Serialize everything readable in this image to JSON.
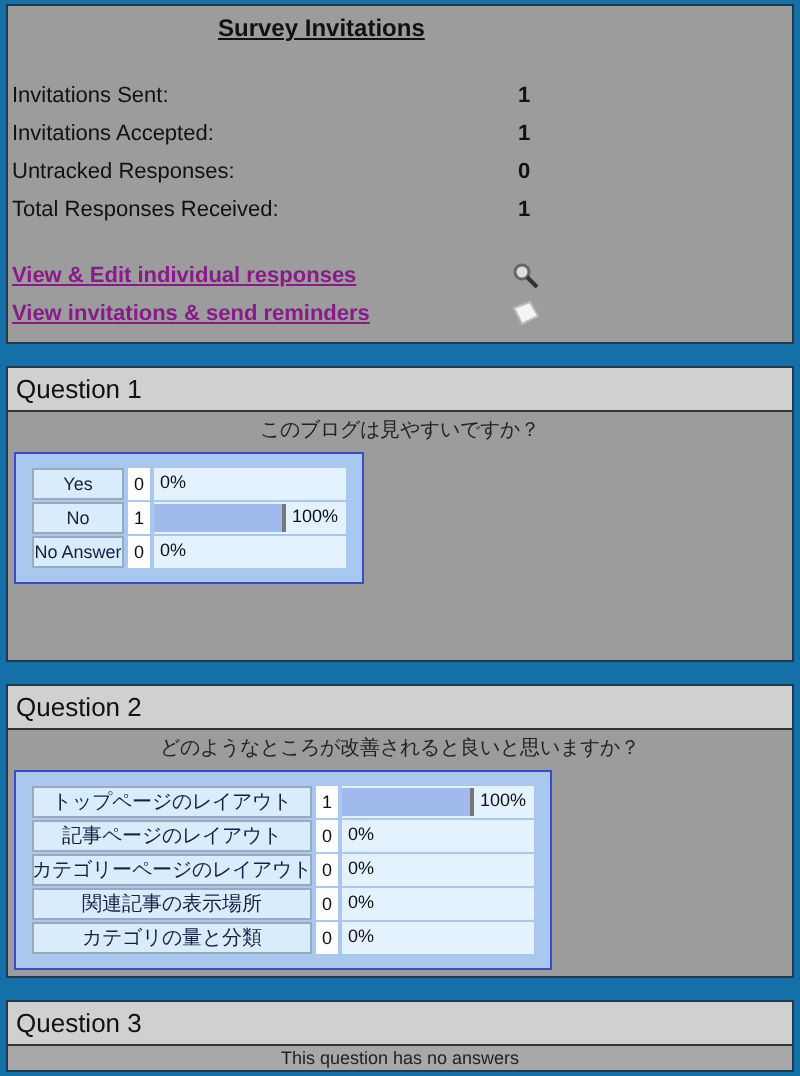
{
  "summary": {
    "title": "Survey Invitations",
    "stats": [
      {
        "label": "Invitations Sent:",
        "value": "1"
      },
      {
        "label": "Invitations Accepted:",
        "value": "1"
      },
      {
        "label": "Untracked Responses:",
        "value": "0"
      },
      {
        "label": "Total Responses Received:",
        "value": "1"
      }
    ],
    "links": [
      {
        "label": "View & Edit individual responses"
      },
      {
        "label": "View invitations & send reminders"
      }
    ]
  },
  "questions": [
    {
      "title": "Question 1",
      "text": "このブログは見やすいですか？",
      "answers": [
        {
          "label": "Yes",
          "count": "0",
          "percent": "0%"
        },
        {
          "label": "No",
          "count": "1",
          "percent": "100%"
        },
        {
          "label": "No Answer",
          "count": "0",
          "percent": "0%"
        }
      ]
    },
    {
      "title": "Question 2",
      "text": "どのようなところが改善されると良いと思いますか？",
      "answers": [
        {
          "label": "トップページのレイアウト",
          "count": "1",
          "percent": "100%"
        },
        {
          "label": "記事ページのレイアウト",
          "count": "0",
          "percent": "0%"
        },
        {
          "label": "カテゴリーページのレイアウト",
          "count": "0",
          "percent": "0%"
        },
        {
          "label": "関連記事の表示場所",
          "count": "0",
          "percent": "0%"
        },
        {
          "label": "カテゴリの量と分類",
          "count": "0",
          "percent": "0%"
        }
      ]
    },
    {
      "title": "Question 3",
      "empty_note": "This question has no answers"
    }
  ]
}
